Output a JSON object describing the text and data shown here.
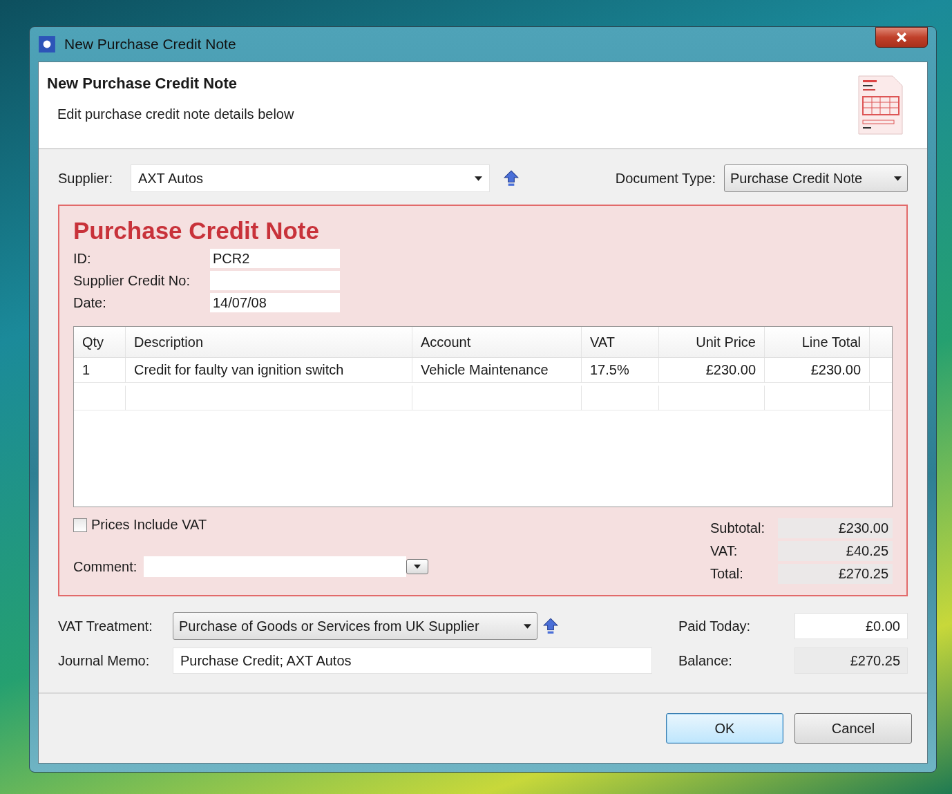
{
  "window": {
    "title": "New Purchase Credit Note"
  },
  "header": {
    "title": "New Purchase Credit Note",
    "subtitle": "Edit purchase credit note details below"
  },
  "supplier": {
    "label": "Supplier:",
    "value": "AXT Autos"
  },
  "document_type": {
    "label": "Document Type:",
    "value": "Purchase Credit Note"
  },
  "form": {
    "title": "Purchase Credit Note",
    "fields": [
      {
        "label": "ID:",
        "value": "PCR2"
      },
      {
        "label": "Supplier Credit No:"
      },
      {
        "label": "Date:",
        "value": "14/07/08"
      }
    ],
    "table": {
      "columns": [
        "Qty",
        "Description",
        "Account",
        "VAT",
        "Unit Price",
        "Line Total"
      ],
      "rows": [
        [
          "1",
          "Credit for faulty van ignition switch",
          "Vehicle Maintenance",
          "17.5%",
          "£230.00",
          "£230.00"
        ]
      ]
    },
    "prices_include_vat": {
      "label": "Prices Include VAT",
      "checked": false
    },
    "comment": {
      "label": "Comment:"
    },
    "totals": [
      {
        "label": "Subtotal:",
        "value": "£230.00"
      },
      {
        "label": "VAT:",
        "value": "£40.25"
      },
      {
        "label": "Total:",
        "value": "£270.25"
      }
    ]
  },
  "vat_treatment": {
    "label": "VAT Treatment:",
    "value": "Purchase of Goods or Services from UK Supplier"
  },
  "journal_memo": {
    "label": "Journal Memo:",
    "value": "Purchase Credit; AXT Autos"
  },
  "paid_today": {
    "label": "Paid Today:",
    "value": "£0.00"
  },
  "balance": {
    "label": "Balance:",
    "value": "£270.25"
  },
  "buttons": [
    {
      "label": "OK",
      "default": true
    },
    {
      "label": "Cancel",
      "default": false
    }
  ]
}
